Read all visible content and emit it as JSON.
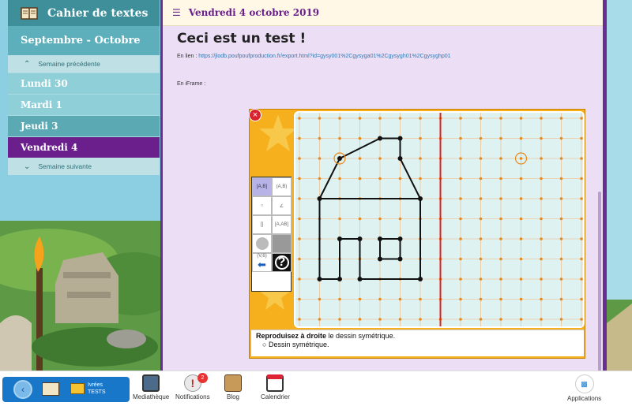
{
  "sidebar": {
    "title": "Cahier de textes",
    "month": "Septembre - Octobre",
    "prev_week": "Semaine précédente",
    "next_week": "Semaine suivante",
    "days": [
      {
        "label": "Lundi 30"
      },
      {
        "label": "Mardi 1"
      },
      {
        "label": "Jeudi 3"
      },
      {
        "label": "Vendredi 4"
      }
    ]
  },
  "header": {
    "date": "Vendredi 4 octobre 2019"
  },
  "content": {
    "title": "Ceci est un test !",
    "link_prefix": "En lien : ",
    "link_url": "https://jlodb.poufpoufproduction.fr/export.html?id=gysy001%2Cgysyga01%2Cgysygh01%2Cgysyghp01",
    "iframe_label": "En iFrame :"
  },
  "exercise": {
    "instruction_bold1": "Reproduisez à ",
    "instruction_bold2": "droite",
    "instruction_rest": " le dessin symétrique.",
    "option": "Dessin symétrique.",
    "tool_labels": [
      "[A,B]",
      "(A,B)",
      "[]",
      "[A,AB]",
      "(V,6)"
    ]
  },
  "bottombar": {
    "group_line1": "Ivrées",
    "group_line2": "TESTS",
    "apps": [
      {
        "label": "Mediathèque",
        "icon": "media-icon"
      },
      {
        "label": "Notifications",
        "icon": "notification-icon",
        "badge": "2"
      },
      {
        "label": "Blog",
        "icon": "blog-icon"
      },
      {
        "label": "Calendrier",
        "icon": "calendar-icon"
      }
    ],
    "applications": "Applications"
  },
  "colors": {
    "accent": "#6a1f8c",
    "teal": "#3e8f9a",
    "link": "#2a7ab8"
  }
}
